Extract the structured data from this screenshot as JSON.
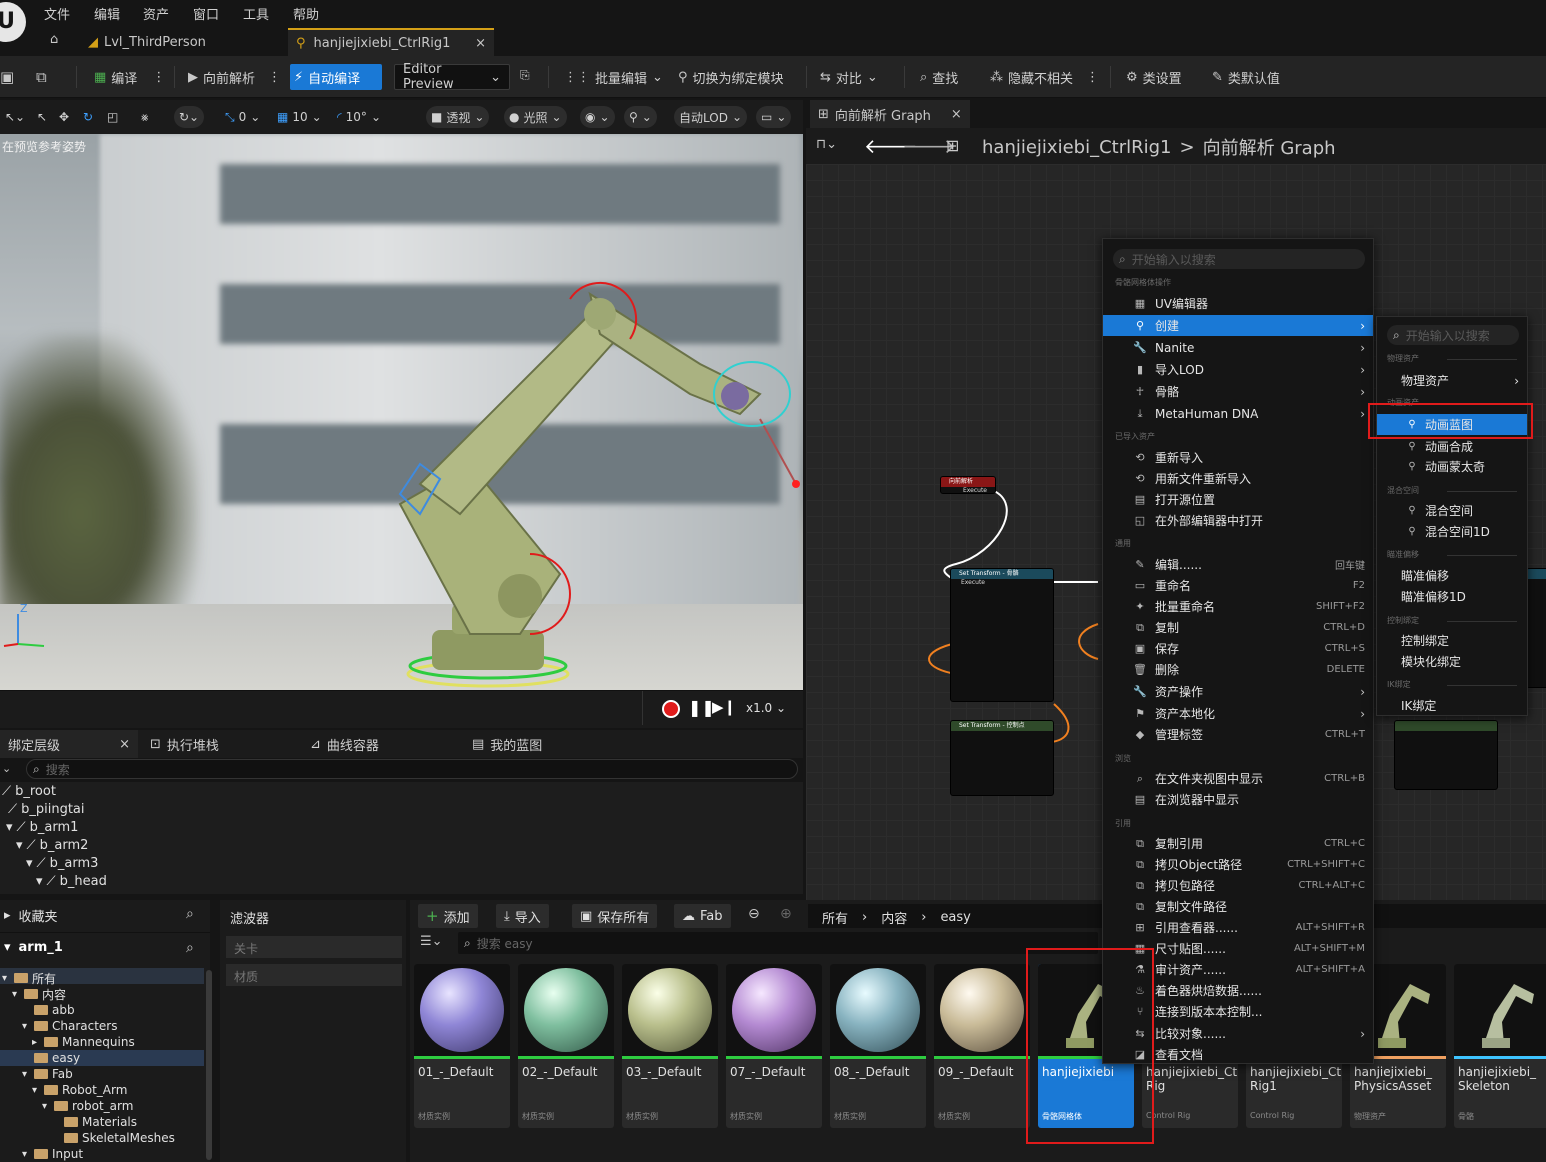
{
  "menubar": {
    "items": [
      "文件",
      "编辑",
      "资产",
      "窗口",
      "工具",
      "帮助"
    ]
  },
  "tabs": {
    "level": "Lvl_ThirdPerson",
    "asset": "hanjiejixiebi_CtrlRig1",
    "close": "×"
  },
  "toolbar": {
    "compile": "编译",
    "forward_solve": "向前解析",
    "auto_compile": "自动编译",
    "preview_select": "Editor Preview",
    "batch_edit": "批量编辑",
    "switch_rig_module": "切换为绑定模块",
    "diff": "对比",
    "find": "查找",
    "hide_unrelated": "隐藏不相关",
    "class_settings": "类设置",
    "class_defaults": "类默认值"
  },
  "viewport_toolbar": {
    "rot_snap": "0",
    "grid_snap": "10",
    "angle_snap": "10°",
    "perspective": "透视",
    "lighting": "光照",
    "lod": "自动LOD",
    "hint": "在预览参考姿势",
    "playback_speed": "x1.0"
  },
  "bottom_tabs": {
    "rig_hierarchy": "绑定层级",
    "execution_stack": "执行堆栈",
    "curve_container": "曲线容器",
    "my_blueprint": "我的蓝图",
    "search_placeholder": "搜索",
    "close": "×"
  },
  "hierarchy": [
    "b_root",
    "b_piingtai",
    "b_arm1",
    "b_arm2",
    "b_arm3",
    "b_head"
  ],
  "graph": {
    "tab_label": "向前解析 Graph",
    "breadcrumb_asset": "hanjiejixiebi_CtrlRig1",
    "breadcrumb_sep": ">",
    "breadcrumb_graph": "向前解析 Graph"
  },
  "content_browser": {
    "favorites": "收藏夹",
    "project": "arm_1",
    "filters": "滤波器",
    "filter_items": [
      "关卡",
      "材质"
    ],
    "tree": [
      {
        "label": "所有",
        "level": 0
      },
      {
        "label": "内容",
        "level": 1
      },
      {
        "label": "abb",
        "level": 2
      },
      {
        "label": "Characters",
        "level": 2
      },
      {
        "label": "Mannequins",
        "level": 3
      },
      {
        "label": "easy",
        "level": 2
      },
      {
        "label": "Fab",
        "level": 2
      },
      {
        "label": "Robot_Arm",
        "level": 3
      },
      {
        "label": "robot_arm",
        "level": 4
      },
      {
        "label": "Materials",
        "level": 5
      },
      {
        "label": "SkeletalMeshes",
        "level": 5
      },
      {
        "label": "Input",
        "level": 2
      }
    ],
    "add": "添加",
    "import": "导入",
    "save_all": "保存所有",
    "fab": "Fab",
    "path": [
      "所有",
      "内容",
      "easy"
    ],
    "search_placeholder": "搜索 easy",
    "assets": [
      {
        "name": "01_-_Default",
        "type": "材质实例",
        "color": "#8f86d6"
      },
      {
        "name": "02_-_Default",
        "type": "材质实例",
        "color": "#7fbf9f"
      },
      {
        "name": "03_-_Default",
        "type": "材质实例",
        "color": "#b9bf8c"
      },
      {
        "name": "07_-_Default",
        "type": "材质实例",
        "color": "#b48ad2"
      },
      {
        "name": "08_-_Default",
        "type": "材质实例",
        "color": "#88b3c0"
      },
      {
        "name": "09_-_Default",
        "type": "材质实例",
        "color": "#c9bb98"
      },
      {
        "name": "hanjiejixiebi",
        "type": "骨骼网格体",
        "color": "#2ecc40"
      },
      {
        "name": "hanjiejixiebi_Ctrl Rig",
        "type": "Control Rig",
        "color": "#2d7ef2"
      },
      {
        "name": "hanjiejixiebi_Ctrl Rig1",
        "type": "Control Rig",
        "color": "#2d7ef2"
      },
      {
        "name": "hanjiejixiebi_ PhysicsAsset",
        "type": "物理资产",
        "color": "#f0a060"
      },
      {
        "name": "hanjiejixiebi_ Skeleton",
        "type": "骨骼",
        "color": "#3ec4ff"
      }
    ]
  },
  "context_menu": {
    "search_placeholder": "开始输入以搜索",
    "sections": {
      "skeletal_mesh_actions": "骨骼网格体操作",
      "imported_asset": "已导入资产",
      "common": "通用",
      "browse": "浏览",
      "references": "引用"
    },
    "items": {
      "uv_editor": "UV编辑器",
      "create": "创建",
      "nanite": "Nanite",
      "import_lod": "导入LOD",
      "skeleton": "骨骼",
      "metahuman_dna": "MetaHuman DNA",
      "reimport": "重新导入",
      "reimport_with_file": "用新文件重新导入",
      "open_source_location": "打开源位置",
      "open_in_external_editor": "在外部编辑器中打开",
      "edit": "编辑......",
      "rename": "重命名",
      "batch_rename": "批量重命名",
      "duplicate": "复制",
      "save": "保存",
      "delete": "删除",
      "asset_actions": "资产操作",
      "asset_localization": "资产本地化",
      "manage_tags": "管理标签",
      "show_in_folder_view": "在文件夹视图中显示",
      "show_in_explorer": "在浏览器中显示",
      "copy_reference": "复制引用",
      "copy_object_path": "拷贝Object路径",
      "copy_package_path": "拷贝包路径",
      "copy_file_path": "复制文件路径",
      "reference_viewer": "引用查看器......",
      "size_map": "尺寸贴图......",
      "audit_assets": "审计资产......",
      "shader_cook_stats": "着色器烘焙数据......",
      "connect_source_control": "连接到版本本控制...",
      "diff_against": "比较对象......",
      "view_docs": "查看文档"
    },
    "shortcuts": {
      "edit": "回车键",
      "rename": "F2",
      "batch_rename": "SHIFT+F2",
      "duplicate": "CTRL+D",
      "save": "CTRL+S",
      "delete": "DELETE",
      "manage_tags": "CTRL+T",
      "show_in_folder_view": "CTRL+B",
      "copy_reference": "CTRL+C",
      "copy_object_path": "CTRL+SHIFT+C",
      "copy_package_path": "CTRL+ALT+C",
      "reference_viewer": "ALT+SHIFT+R",
      "size_map": "ALT+SHIFT+M",
      "audit_assets": "ALT+SHIFT+A"
    }
  },
  "submenu": {
    "search_placeholder": "开始输入以搜索",
    "sections": {
      "physics_asset": "物理资产",
      "animation_asset": "动画资产",
      "blend_space": "混合空间",
      "aim_offset": "瞄准偏移",
      "control_rig": "控制绑定",
      "ik_rig": "IK绑定"
    },
    "items": {
      "physics_asset": "物理资产",
      "anim_blueprint": "动画蓝图",
      "anim_composite": "动画合成",
      "anim_montage": "动画蒙太奇",
      "blend_space": "混合空间",
      "blend_space_1d": "混合空间1D",
      "aim_offset": "瞄准偏移",
      "aim_offset_1d": "瞄准偏移1D",
      "control_rig": "控制绑定",
      "modular_rig": "模块化绑定",
      "ik_rig": "IK绑定"
    }
  },
  "graph_nodes": {
    "forward_solve_title": "向前解析",
    "execute": "Execute",
    "set_transform_title": "Set Transform - 骨骼",
    "set_transform_title2": "Set Transform - 控制点"
  }
}
